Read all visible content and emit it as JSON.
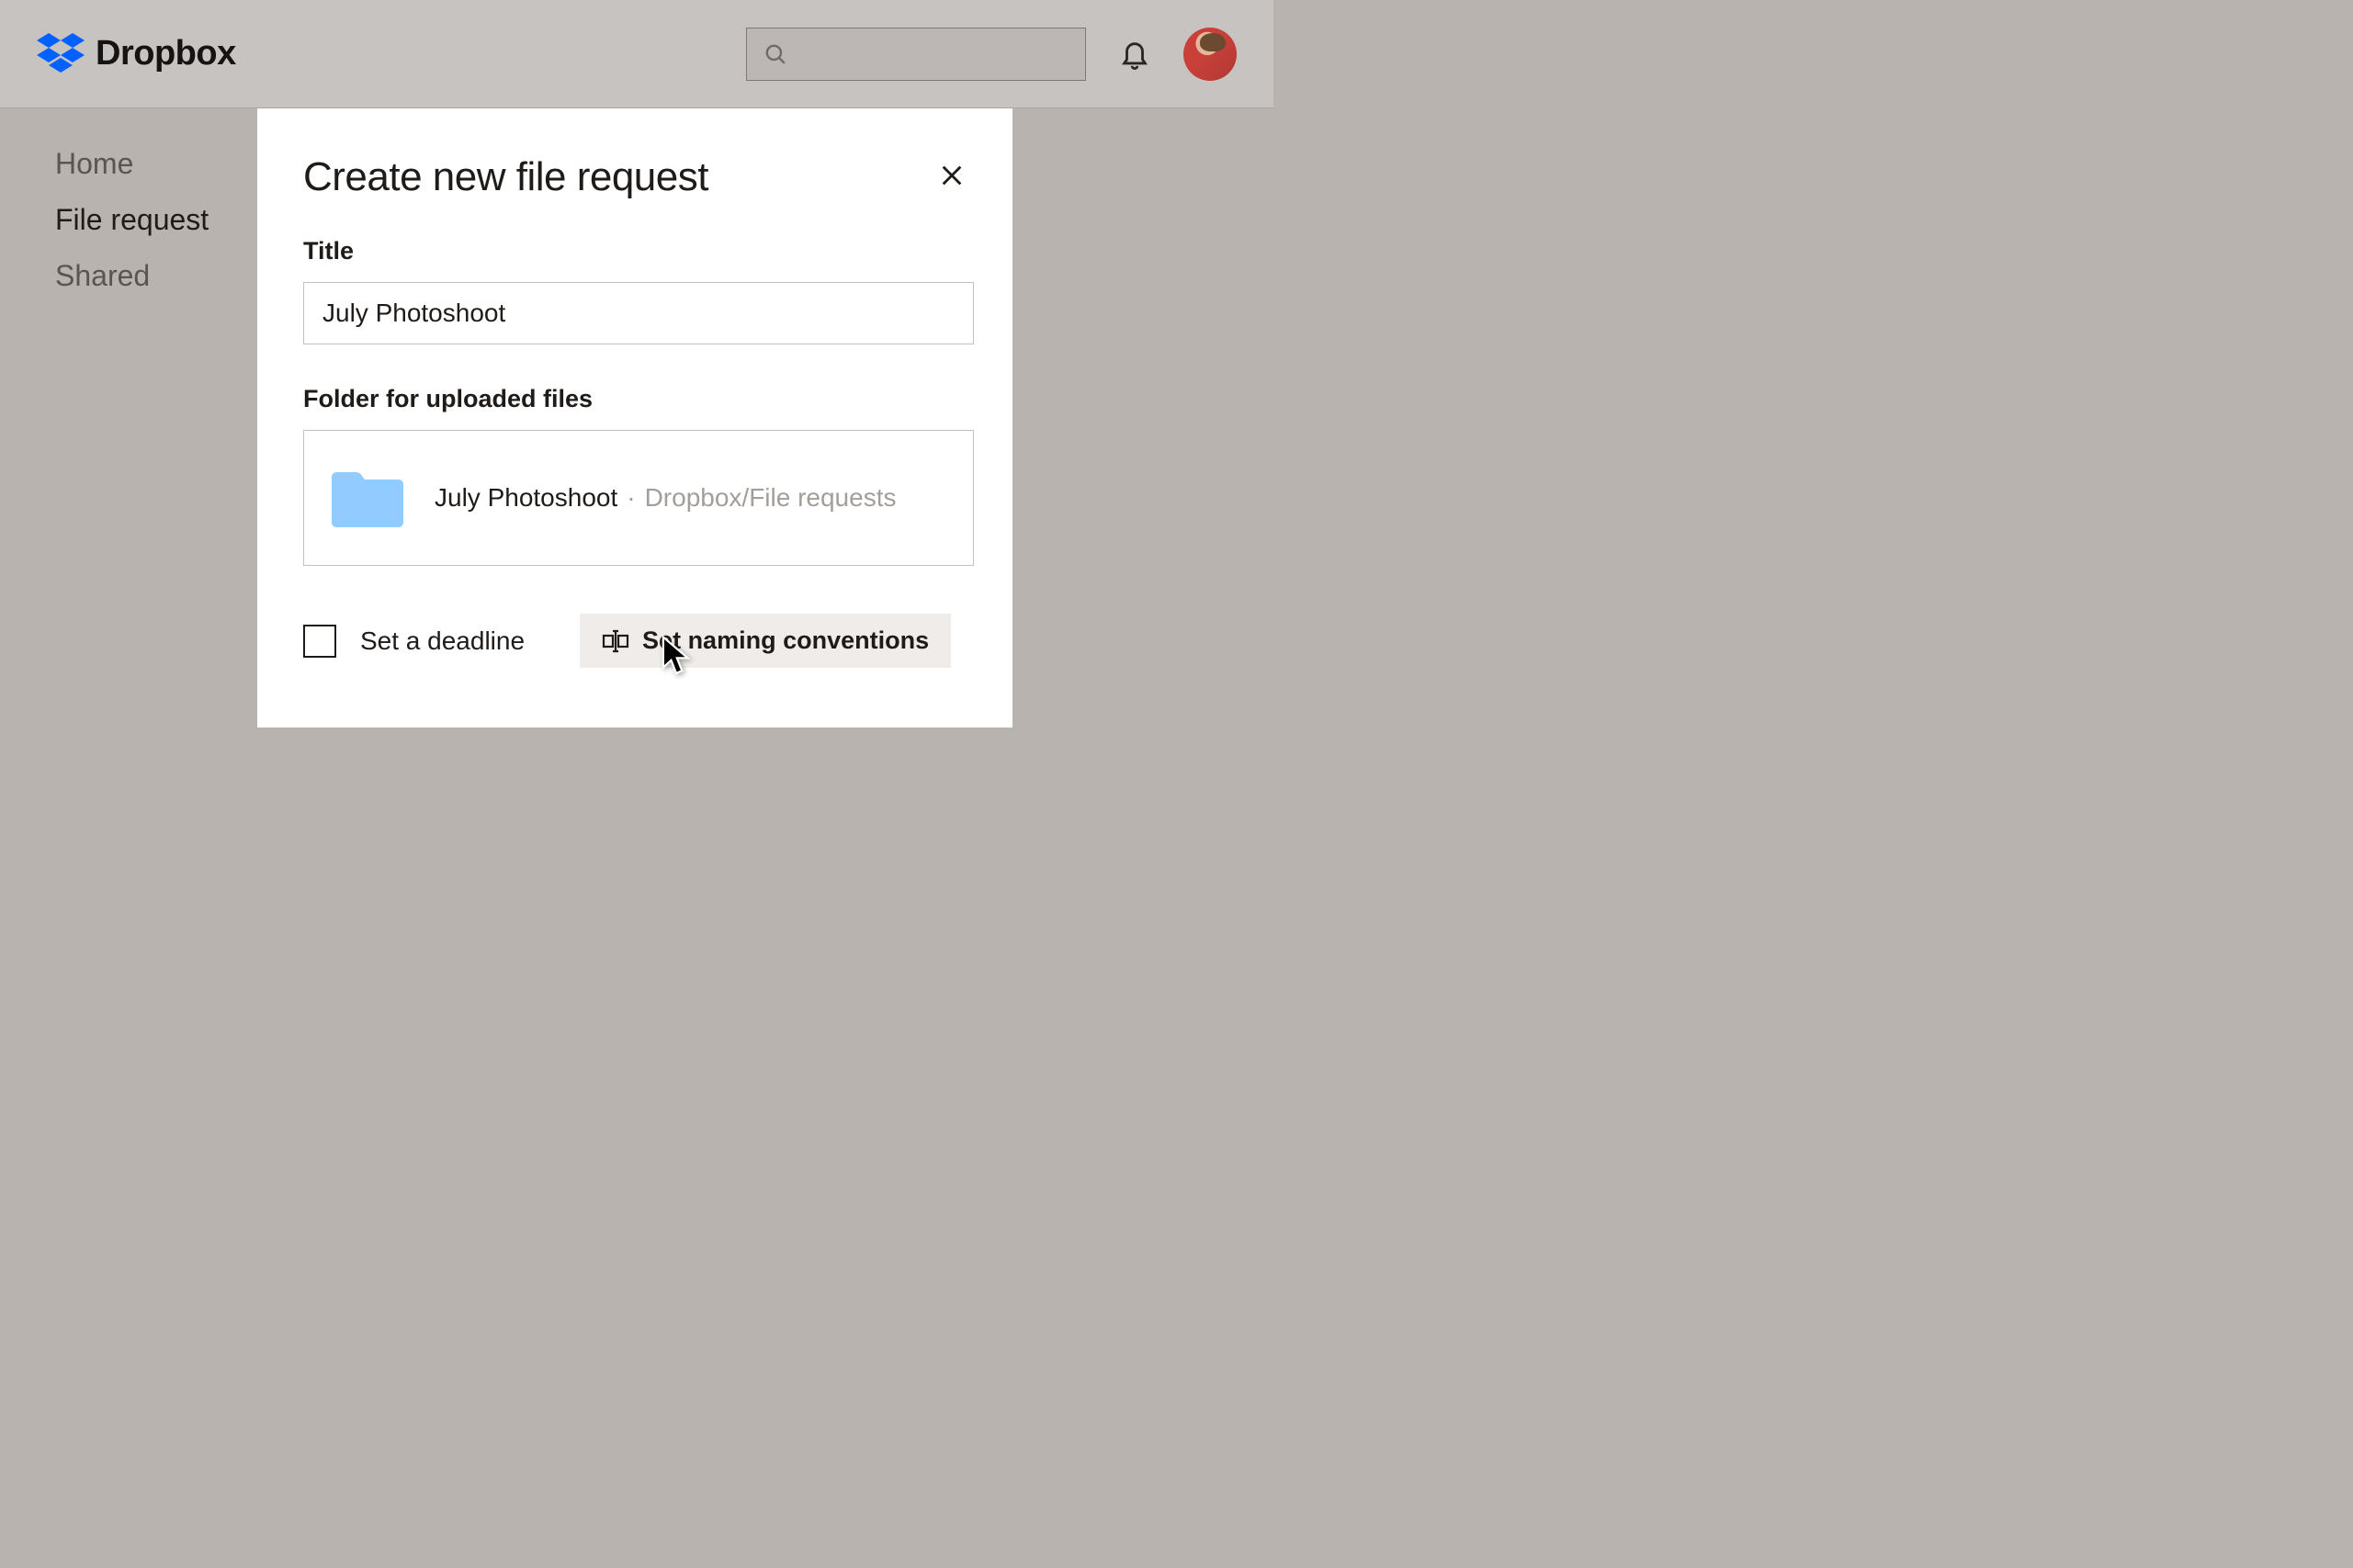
{
  "brand": {
    "name": "Dropbox"
  },
  "header": {
    "search_placeholder": ""
  },
  "sidebar": {
    "items": [
      {
        "label": "Home",
        "active": false
      },
      {
        "label": "File request",
        "active": true
      },
      {
        "label": "Shared",
        "active": false
      }
    ]
  },
  "modal": {
    "title": "Create new file request",
    "title_label": "Title",
    "title_value": "July Photoshoot",
    "folder_label": "Folder for uploaded files",
    "folder_name": "July Photoshoot",
    "folder_separator": "·",
    "folder_path": "Dropbox/File requests",
    "deadline_label": "Set a deadline",
    "naming_label": "Set naming conventions"
  }
}
